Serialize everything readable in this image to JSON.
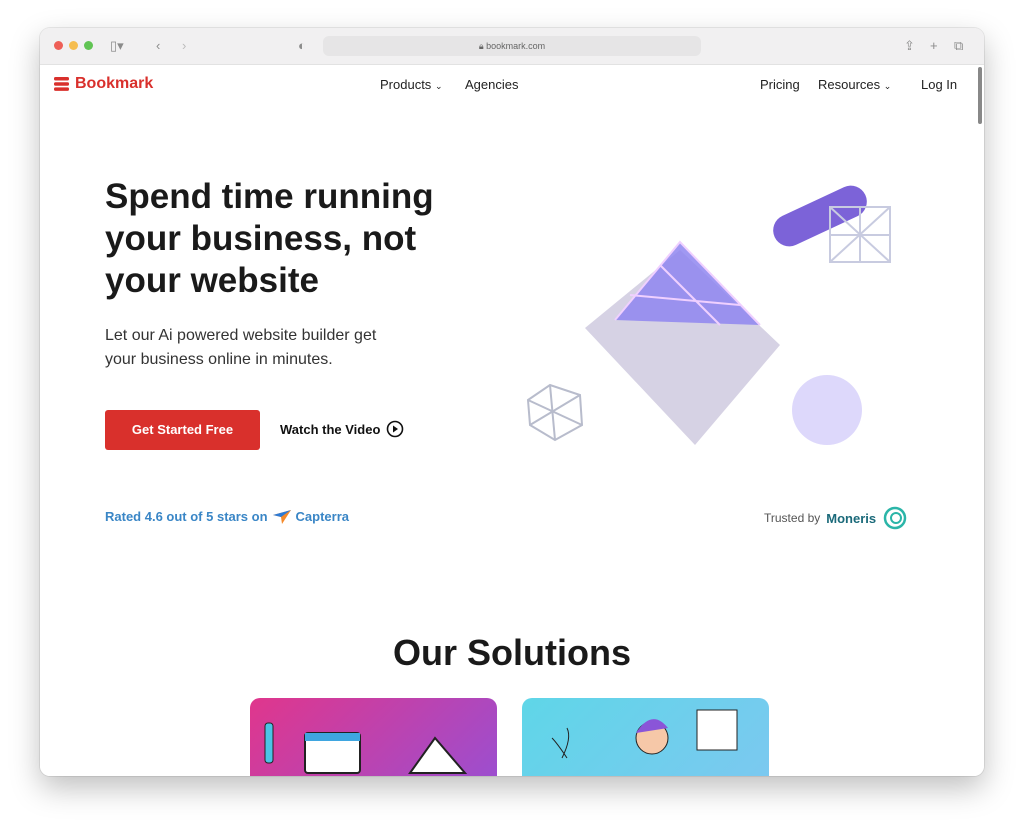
{
  "browser": {
    "url": "bookmark.com",
    "traffic_colors": [
      "#ee5f57",
      "#f5bd4f",
      "#61c454"
    ]
  },
  "nav": {
    "brand": "Bookmark",
    "brand_color": "#d9302c",
    "products": "Products",
    "agencies": "Agencies",
    "pricing": "Pricing",
    "resources": "Resources",
    "login": "Log In"
  },
  "hero": {
    "title": "Spend time running your business, not your website",
    "subtitle": "Let our Ai powered website builder get your business online in minutes.",
    "cta": "Get Started Free",
    "video": "Watch the Video"
  },
  "social": {
    "rated": "Rated 4.6 out of 5 stars on",
    "capterra": "Capterra",
    "trusted": "Trusted by",
    "moneris": "Moneris"
  },
  "solutions": {
    "title": "Our Solutions"
  }
}
